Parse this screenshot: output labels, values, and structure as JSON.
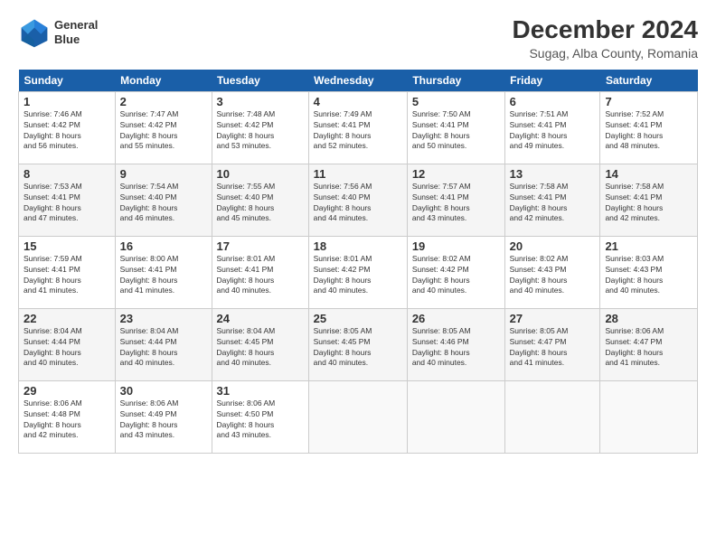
{
  "header": {
    "logo_line1": "General",
    "logo_line2": "Blue",
    "main_title": "December 2024",
    "subtitle": "Sugag, Alba County, Romania"
  },
  "calendar": {
    "headers": [
      "Sunday",
      "Monday",
      "Tuesday",
      "Wednesday",
      "Thursday",
      "Friday",
      "Saturday"
    ],
    "rows": [
      [
        {
          "day": "1",
          "info": "Sunrise: 7:46 AM\nSunset: 4:42 PM\nDaylight: 8 hours\nand 56 minutes."
        },
        {
          "day": "2",
          "info": "Sunrise: 7:47 AM\nSunset: 4:42 PM\nDaylight: 8 hours\nand 55 minutes."
        },
        {
          "day": "3",
          "info": "Sunrise: 7:48 AM\nSunset: 4:42 PM\nDaylight: 8 hours\nand 53 minutes."
        },
        {
          "day": "4",
          "info": "Sunrise: 7:49 AM\nSunset: 4:41 PM\nDaylight: 8 hours\nand 52 minutes."
        },
        {
          "day": "5",
          "info": "Sunrise: 7:50 AM\nSunset: 4:41 PM\nDaylight: 8 hours\nand 50 minutes."
        },
        {
          "day": "6",
          "info": "Sunrise: 7:51 AM\nSunset: 4:41 PM\nDaylight: 8 hours\nand 49 minutes."
        },
        {
          "day": "7",
          "info": "Sunrise: 7:52 AM\nSunset: 4:41 PM\nDaylight: 8 hours\nand 48 minutes."
        }
      ],
      [
        {
          "day": "8",
          "info": "Sunrise: 7:53 AM\nSunset: 4:41 PM\nDaylight: 8 hours\nand 47 minutes."
        },
        {
          "day": "9",
          "info": "Sunrise: 7:54 AM\nSunset: 4:40 PM\nDaylight: 8 hours\nand 46 minutes."
        },
        {
          "day": "10",
          "info": "Sunrise: 7:55 AM\nSunset: 4:40 PM\nDaylight: 8 hours\nand 45 minutes."
        },
        {
          "day": "11",
          "info": "Sunrise: 7:56 AM\nSunset: 4:40 PM\nDaylight: 8 hours\nand 44 minutes."
        },
        {
          "day": "12",
          "info": "Sunrise: 7:57 AM\nSunset: 4:41 PM\nDaylight: 8 hours\nand 43 minutes."
        },
        {
          "day": "13",
          "info": "Sunrise: 7:58 AM\nSunset: 4:41 PM\nDaylight: 8 hours\nand 42 minutes."
        },
        {
          "day": "14",
          "info": "Sunrise: 7:58 AM\nSunset: 4:41 PM\nDaylight: 8 hours\nand 42 minutes."
        }
      ],
      [
        {
          "day": "15",
          "info": "Sunrise: 7:59 AM\nSunset: 4:41 PM\nDaylight: 8 hours\nand 41 minutes."
        },
        {
          "day": "16",
          "info": "Sunrise: 8:00 AM\nSunset: 4:41 PM\nDaylight: 8 hours\nand 41 minutes."
        },
        {
          "day": "17",
          "info": "Sunrise: 8:01 AM\nSunset: 4:41 PM\nDaylight: 8 hours\nand 40 minutes."
        },
        {
          "day": "18",
          "info": "Sunrise: 8:01 AM\nSunset: 4:42 PM\nDaylight: 8 hours\nand 40 minutes."
        },
        {
          "day": "19",
          "info": "Sunrise: 8:02 AM\nSunset: 4:42 PM\nDaylight: 8 hours\nand 40 minutes."
        },
        {
          "day": "20",
          "info": "Sunrise: 8:02 AM\nSunset: 4:43 PM\nDaylight: 8 hours\nand 40 minutes."
        },
        {
          "day": "21",
          "info": "Sunrise: 8:03 AM\nSunset: 4:43 PM\nDaylight: 8 hours\nand 40 minutes."
        }
      ],
      [
        {
          "day": "22",
          "info": "Sunrise: 8:04 AM\nSunset: 4:44 PM\nDaylight: 8 hours\nand 40 minutes."
        },
        {
          "day": "23",
          "info": "Sunrise: 8:04 AM\nSunset: 4:44 PM\nDaylight: 8 hours\nand 40 minutes."
        },
        {
          "day": "24",
          "info": "Sunrise: 8:04 AM\nSunset: 4:45 PM\nDaylight: 8 hours\nand 40 minutes."
        },
        {
          "day": "25",
          "info": "Sunrise: 8:05 AM\nSunset: 4:45 PM\nDaylight: 8 hours\nand 40 minutes."
        },
        {
          "day": "26",
          "info": "Sunrise: 8:05 AM\nSunset: 4:46 PM\nDaylight: 8 hours\nand 40 minutes."
        },
        {
          "day": "27",
          "info": "Sunrise: 8:05 AM\nSunset: 4:47 PM\nDaylight: 8 hours\nand 41 minutes."
        },
        {
          "day": "28",
          "info": "Sunrise: 8:06 AM\nSunset: 4:47 PM\nDaylight: 8 hours\nand 41 minutes."
        }
      ],
      [
        {
          "day": "29",
          "info": "Sunrise: 8:06 AM\nSunset: 4:48 PM\nDaylight: 8 hours\nand 42 minutes."
        },
        {
          "day": "30",
          "info": "Sunrise: 8:06 AM\nSunset: 4:49 PM\nDaylight: 8 hours\nand 43 minutes."
        },
        {
          "day": "31",
          "info": "Sunrise: 8:06 AM\nSunset: 4:50 PM\nDaylight: 8 hours\nand 43 minutes."
        },
        {
          "day": "",
          "info": ""
        },
        {
          "day": "",
          "info": ""
        },
        {
          "day": "",
          "info": ""
        },
        {
          "day": "",
          "info": ""
        }
      ]
    ]
  }
}
